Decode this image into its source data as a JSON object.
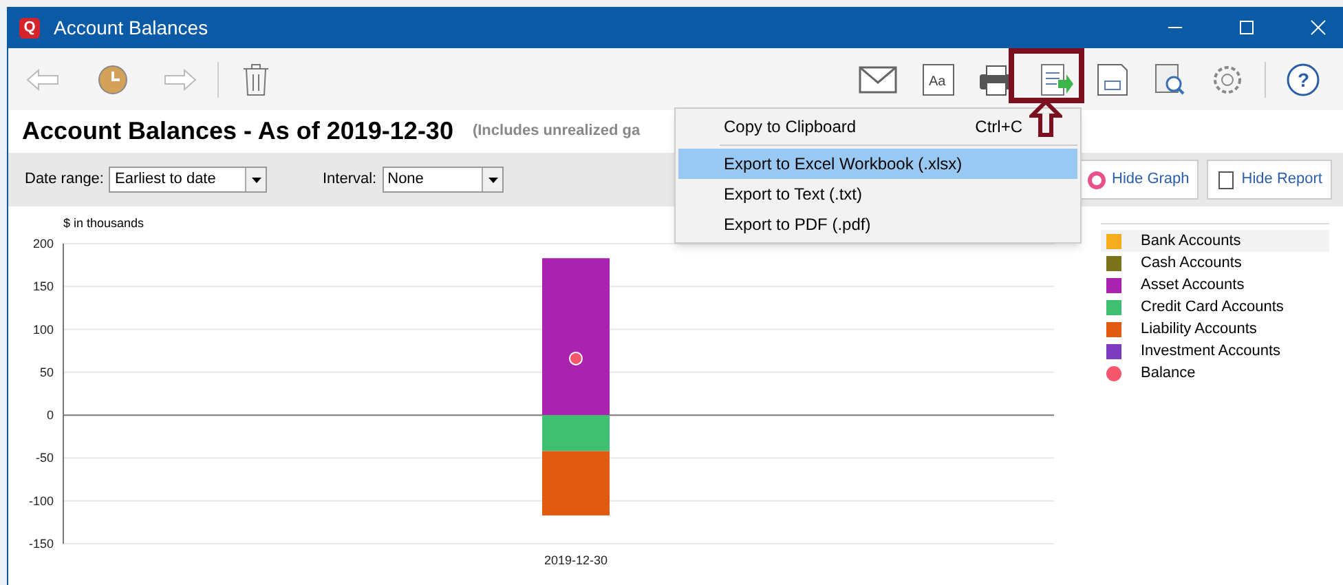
{
  "window": {
    "title": "Account Balances",
    "logo": "Q"
  },
  "toolbar": {
    "font_icon_text": "Aa",
    "help_icon_text": "?"
  },
  "report": {
    "title": "Account Balances - As of 2019-12-30",
    "note": "(Includes unrealized ga"
  },
  "filters": [
    {
      "label": "Date range:",
      "value": "Earliest to date"
    },
    {
      "label": "Interval:",
      "value": "None"
    }
  ],
  "buttons": [
    "Hide Graph",
    "Hide Report"
  ],
  "menu": [
    {
      "label": "Copy to Clipboard",
      "shortcut": "Ctrl+C",
      "selected": false
    },
    {
      "label": "Export to Excel Workbook (.xlsx)",
      "selected": true
    },
    {
      "label": "Export to Text (.txt)",
      "selected": false
    },
    {
      "label": "Export to PDF (.pdf)",
      "selected": false
    }
  ],
  "chart": {
    "chart_data": {
      "type": "bar",
      "stacked": true,
      "grid": true,
      "ylabel": "$ in thousands",
      "categories": [
        "2019-12-30"
      ],
      "series": [
        {
          "name": "Bank Accounts",
          "color": "#f5ac1f",
          "values": [
            0
          ]
        },
        {
          "name": "Cash Accounts",
          "color": "#7b731b",
          "values": [
            0
          ]
        },
        {
          "name": "Asset Accounts",
          "color": "#aa22b0",
          "values": [
            183
          ]
        },
        {
          "name": "Credit Card Accounts",
          "color": "#3fbf72",
          "values": [
            -42
          ]
        },
        {
          "name": "Liability Accounts",
          "color": "#e05a12",
          "values": [
            -75
          ]
        },
        {
          "name": "Investment Accounts",
          "color": "#7d3cc0",
          "values": [
            0
          ]
        },
        {
          "name": "Balance",
          "type": "scatter",
          "color": "#f4576b",
          "values": [
            66
          ]
        }
      ],
      "ylim": [
        -150,
        200
      ],
      "yticks": [
        200,
        150,
        100,
        50,
        0,
        -50,
        -100,
        -150
      ]
    },
    "legend_selected": [
      true,
      false,
      false,
      false,
      false,
      false,
      false
    ]
  }
}
